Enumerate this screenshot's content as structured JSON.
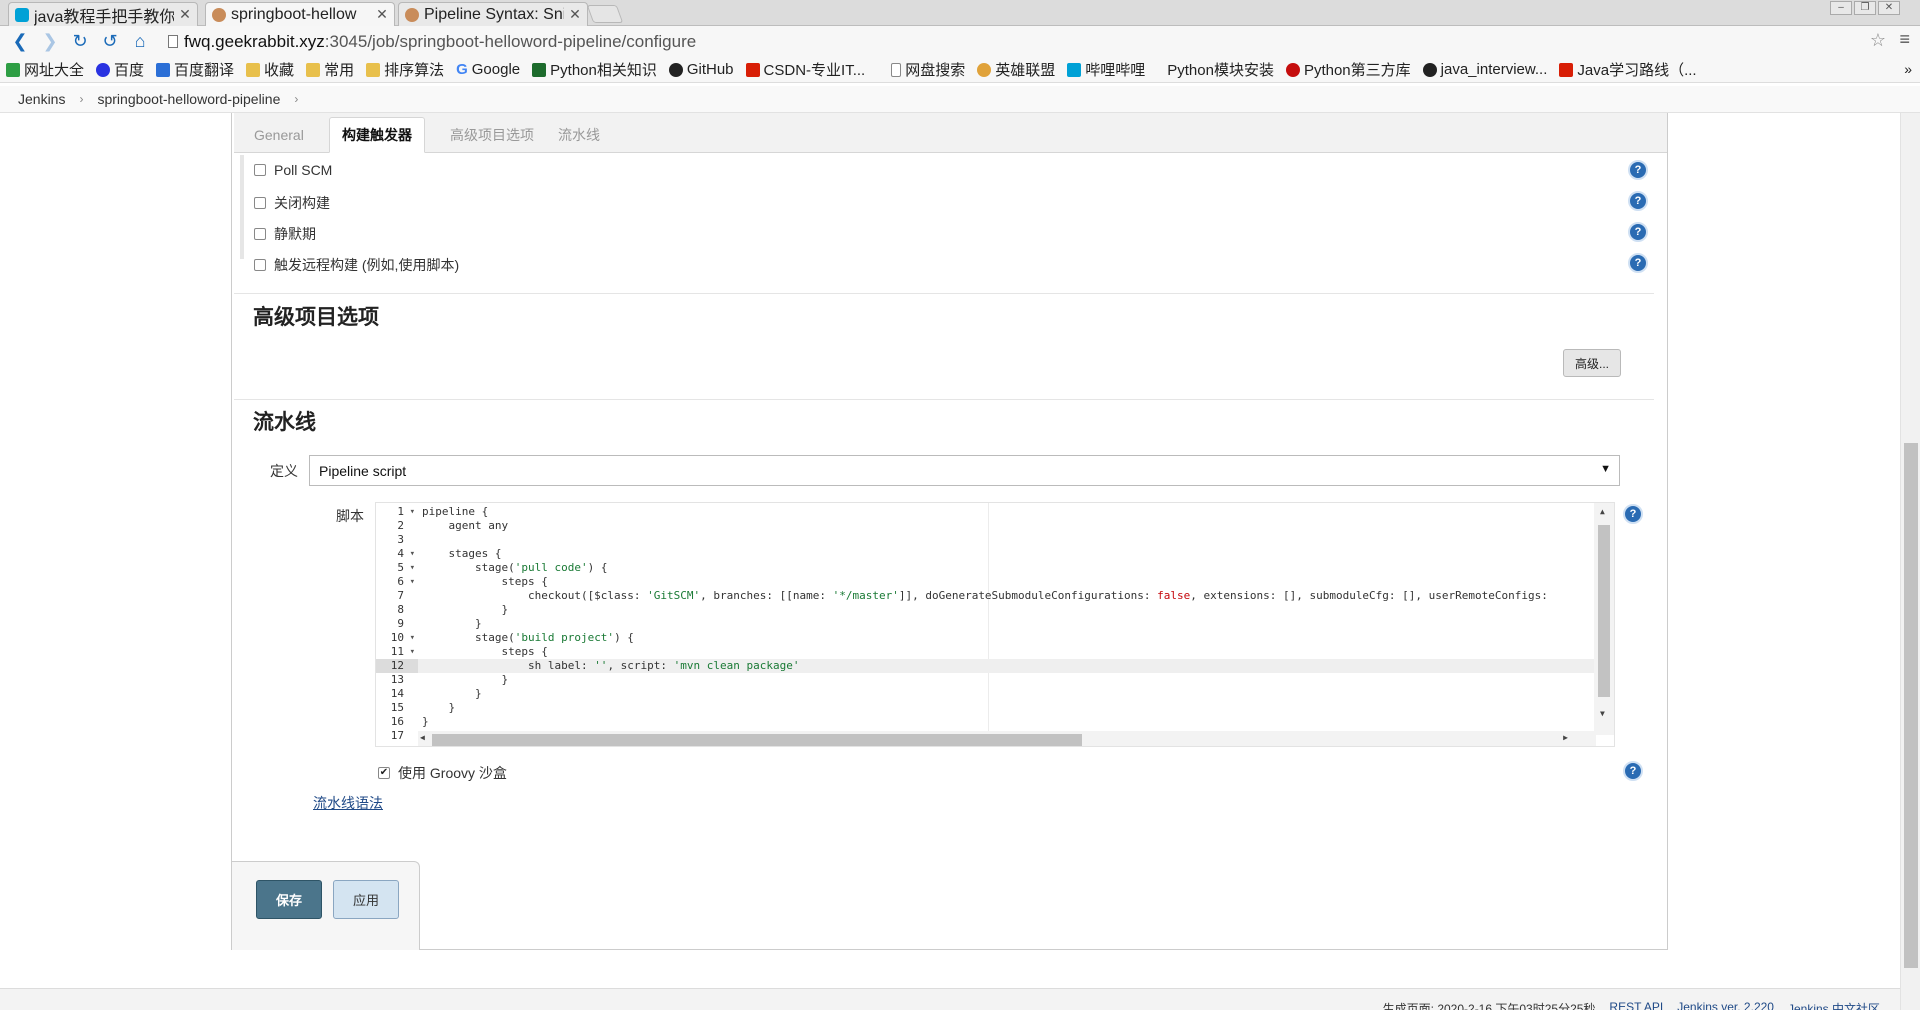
{
  "browser": {
    "tabs": [
      {
        "title": "java教程手把手教你J",
        "active": false
      },
      {
        "title": "springboot-hellow",
        "active": true
      },
      {
        "title": "Pipeline Syntax: Sni",
        "active": false
      }
    ],
    "url_host": "fwq.geekrabbit.xyz",
    "url_path": ":3045/job/springboot-helloword-pipeline/configure",
    "bookmarks": [
      "网址大全",
      "百度",
      "百度翻译",
      "收藏",
      "常用",
      "排序算法",
      "Google",
      "Python相关知识",
      "GitHub",
      "CSDN-专业IT...",
      "网盘搜索",
      "英雄联盟",
      "哔哩哔哩",
      "Python模块安装",
      "Python第三方库",
      "java_interview...",
      "Java学习路线（..."
    ]
  },
  "breadcrumb": {
    "items": [
      "Jenkins",
      "springboot-helloword-pipeline"
    ]
  },
  "config": {
    "tabs": [
      "General",
      "构建触发器",
      "高级项目选项",
      "流水线"
    ],
    "triggers": [
      "Poll SCM",
      "关闭构建",
      "静默期",
      "触发远程构建 (例如,使用脚本)"
    ],
    "advanced": {
      "title": "高级项目选项",
      "button": "高级..."
    },
    "pipeline": {
      "title": "流水线",
      "definition_label": "定义",
      "definition_value": "Pipeline script",
      "script_label": "脚本",
      "sandbox_label": "使用 Groovy 沙盒",
      "syntax_link": "流水线语法"
    },
    "buttons": {
      "save": "保存",
      "apply": "应用"
    }
  },
  "editor": {
    "active_line": 12,
    "lines": [
      {
        "n": "1",
        "fold": true,
        "parts": [
          [
            "pipeline {",
            ""
          ]
        ]
      },
      {
        "n": "2",
        "fold": false,
        "parts": [
          [
            "    agent any",
            ""
          ]
        ]
      },
      {
        "n": "3",
        "fold": false,
        "parts": [
          [
            "",
            ""
          ]
        ]
      },
      {
        "n": "4",
        "fold": true,
        "parts": [
          [
            "    stages {",
            ""
          ]
        ]
      },
      {
        "n": "5",
        "fold": true,
        "parts": [
          [
            "        stage(",
            ""
          ],
          [
            "'pull code'",
            "str"
          ],
          [
            ") {",
            ""
          ]
        ]
      },
      {
        "n": "6",
        "fold": true,
        "parts": [
          [
            "            steps {",
            ""
          ]
        ]
      },
      {
        "n": "7",
        "fold": false,
        "parts": [
          [
            "                checkout([$class: ",
            ""
          ],
          [
            "'GitSCM'",
            "str"
          ],
          [
            ", branches: [[name: ",
            ""
          ],
          [
            "'*/master'",
            "str"
          ],
          [
            "]], doGenerateSubmoduleConfigurations: ",
            ""
          ],
          [
            "false",
            "bool"
          ],
          [
            ", extensions: [], submoduleCfg: [], userRemoteConfigs:",
            ""
          ]
        ]
      },
      {
        "n": "8",
        "fold": false,
        "parts": [
          [
            "            }",
            ""
          ]
        ]
      },
      {
        "n": "9",
        "fold": false,
        "parts": [
          [
            "        }",
            ""
          ]
        ]
      },
      {
        "n": "10",
        "fold": true,
        "parts": [
          [
            "        stage(",
            ""
          ],
          [
            "'build project'",
            "str"
          ],
          [
            ") {",
            ""
          ]
        ]
      },
      {
        "n": "11",
        "fold": true,
        "parts": [
          [
            "            steps {",
            ""
          ]
        ]
      },
      {
        "n": "12",
        "fold": false,
        "parts": [
          [
            "                sh label: ",
            ""
          ],
          [
            "''",
            "str"
          ],
          [
            ", script: ",
            ""
          ],
          [
            "'mvn clean package'",
            "str"
          ]
        ]
      },
      {
        "n": "13",
        "fold": false,
        "parts": [
          [
            "            }",
            ""
          ]
        ]
      },
      {
        "n": "14",
        "fold": false,
        "parts": [
          [
            "        }",
            ""
          ]
        ]
      },
      {
        "n": "15",
        "fold": false,
        "parts": [
          [
            "    }",
            ""
          ]
        ]
      },
      {
        "n": "16",
        "fold": false,
        "parts": [
          [
            "}",
            ""
          ]
        ]
      },
      {
        "n": "17",
        "fold": false,
        "parts": [
          [
            "",
            ""
          ]
        ]
      }
    ]
  },
  "footer": {
    "generated": "生成页面: 2020-2-16 下午03时25分25秒",
    "rest_api": "REST API",
    "version": "Jenkins ver. 2.220",
    "community": "Jenkins 中文社区"
  },
  "colors": {
    "save_button": "#4b758b",
    "apply_button": "#d4e4f1",
    "help_icon": "#2a6bb3",
    "link": "#204a87",
    "code_string": "#1a7a35",
    "code_boolean": "#c5060b"
  }
}
